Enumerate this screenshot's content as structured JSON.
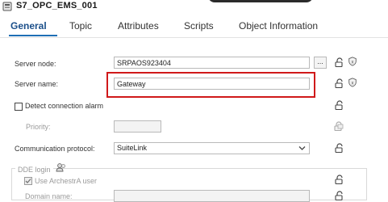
{
  "window": {
    "title": "S7_OPC_EMS_001"
  },
  "tabs": [
    {
      "label": "General",
      "active": true
    },
    {
      "label": "Topic"
    },
    {
      "label": "Attributes"
    },
    {
      "label": "Scripts"
    },
    {
      "label": "Object Information"
    }
  ],
  "form": {
    "server_node": {
      "label": "Server node:",
      "value": "SRPAOS923404",
      "browse_label": "..."
    },
    "server_name": {
      "label": "Server name:",
      "value": "Gateway"
    },
    "detect_connection_alarm": {
      "label": "Detect connection alarm",
      "checked": false
    },
    "priority": {
      "label": "Priority:",
      "value": ""
    },
    "communication_protocol": {
      "label": "Communication protocol:",
      "value": "SuiteLink"
    },
    "dde_login": {
      "group_label": "DDE login",
      "use_archestra_user": {
        "label": "Use ArchestrA user",
        "checked": true
      },
      "domain_name": {
        "label": "Domain name:",
        "value": ""
      }
    }
  },
  "colors": {
    "accent": "#1f6fb5",
    "highlight": "#d0191a"
  },
  "icons": [
    "object-icon",
    "lock-icon",
    "shield-icon",
    "chevron-down-icon",
    "user-icon"
  ]
}
